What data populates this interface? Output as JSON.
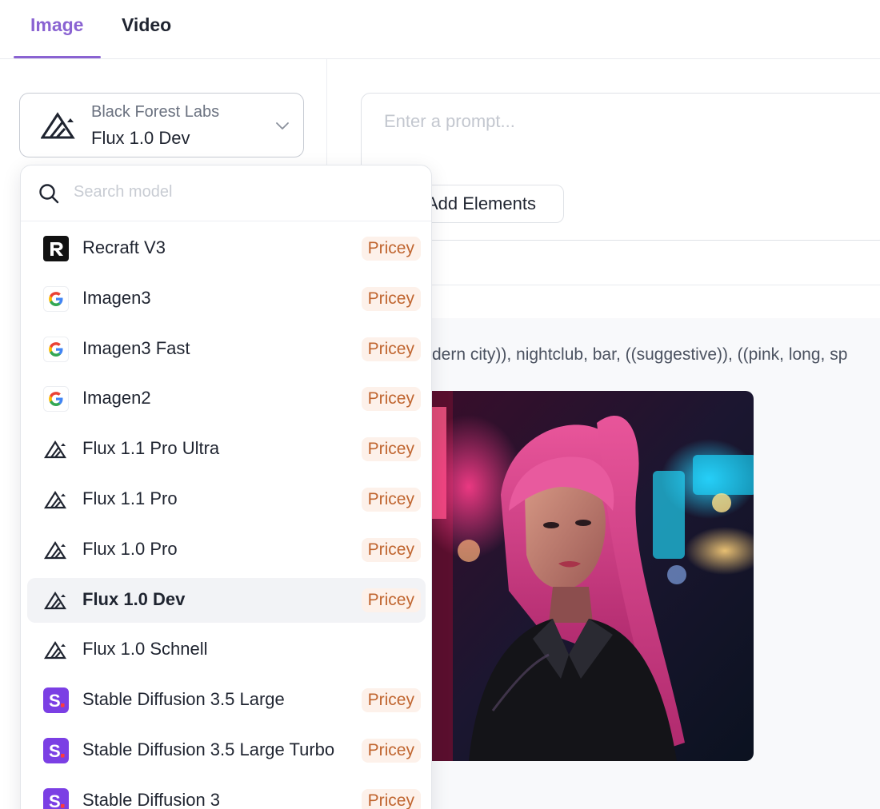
{
  "tabs": [
    {
      "label": "Image",
      "active": true
    },
    {
      "label": "Video",
      "active": false
    }
  ],
  "model_select": {
    "provider": "Black Forest Labs",
    "model": "Flux 1.0 Dev"
  },
  "prompt": {
    "placeholder": "Enter a prompt...",
    "add_elements_label": "Add Elements"
  },
  "result": {
    "prompt_text": "dern city)), nightclub, bar, ((suggestive)), ((pink, long, sp"
  },
  "dropdown": {
    "search_placeholder": "Search model",
    "items": [
      {
        "name": "Recraft V3",
        "icon": "recraft-logo",
        "badge": "Pricey"
      },
      {
        "name": "Imagen3",
        "icon": "google-logo",
        "badge": "Pricey"
      },
      {
        "name": "Imagen3 Fast",
        "icon": "google-logo",
        "badge": "Pricey"
      },
      {
        "name": "Imagen2",
        "icon": "google-logo",
        "badge": "Pricey"
      },
      {
        "name": "Flux 1.1 Pro Ultra",
        "icon": "bfl-logo",
        "badge": "Pricey"
      },
      {
        "name": "Flux 1.1 Pro",
        "icon": "bfl-logo",
        "badge": "Pricey"
      },
      {
        "name": "Flux 1.0 Pro",
        "icon": "bfl-logo",
        "badge": "Pricey"
      },
      {
        "name": "Flux 1.0 Dev",
        "icon": "bfl-logo",
        "badge": "Pricey",
        "selected": true
      },
      {
        "name": "Flux 1.0 Schnell",
        "icon": "bfl-logo",
        "badge": ""
      },
      {
        "name": "Stable Diffusion 3.5 Large",
        "icon": "stability-logo",
        "badge": "Pricey"
      },
      {
        "name": "Stable Diffusion 3.5 Large Turbo",
        "icon": "stability-logo",
        "badge": "Pricey"
      },
      {
        "name": "Stable Diffusion 3",
        "icon": "stability-logo",
        "badge": "Pricey"
      }
    ]
  },
  "colors": {
    "accent": "#8a63d2",
    "badge_bg": "#fdf1ea",
    "badge_text": "#c0652f",
    "stability_purple": "#7b3fe4"
  }
}
